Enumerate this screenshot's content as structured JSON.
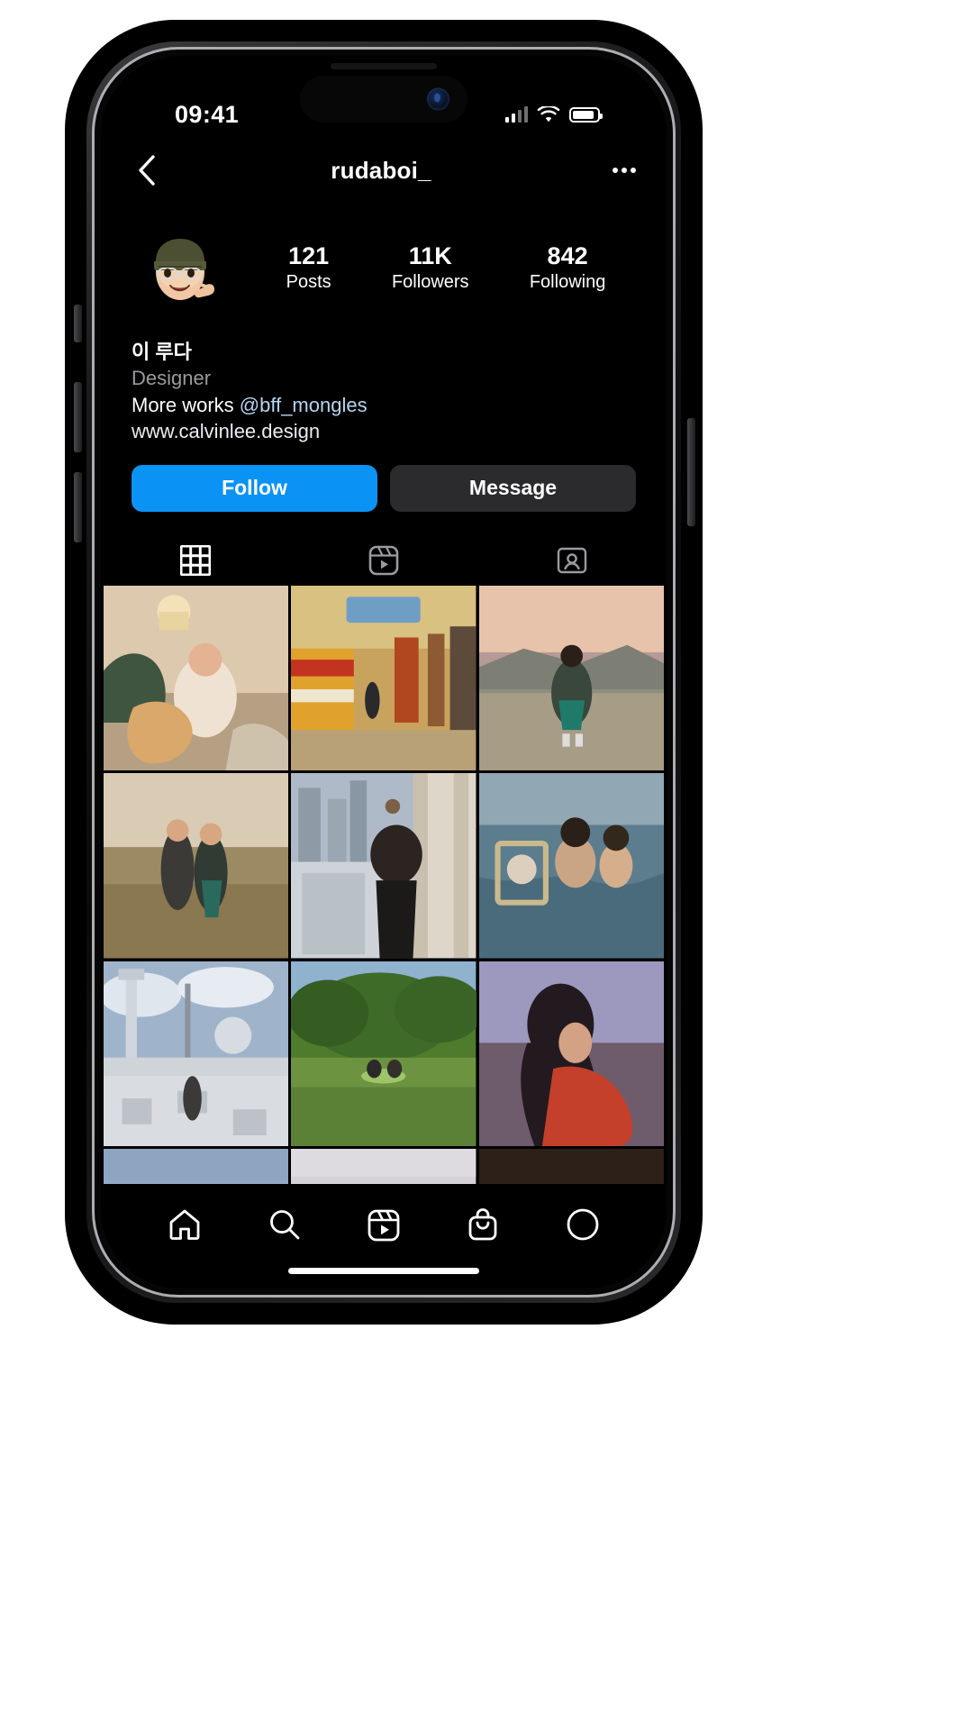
{
  "status_bar": {
    "time": "09:41",
    "signal_icon": "cellular-signal-icon",
    "wifi_icon": "wifi-icon",
    "battery_icon": "battery-icon"
  },
  "nav": {
    "back_icon": "chevron-left-icon",
    "title": "rudaboi_",
    "more_icon": "more-options-icon"
  },
  "profile": {
    "avatar_name": "memoji-avatar",
    "stats": [
      {
        "value": "121",
        "label": "Posts"
      },
      {
        "value": "11K",
        "label": "Followers"
      },
      {
        "value": "842",
        "label": "Following"
      }
    ],
    "bio": {
      "name": "이 루다",
      "category": "Designer",
      "description_prefix": "More works ",
      "mention": "@bff_mongles",
      "link": "www.calvinlee.design"
    },
    "buttons": {
      "follow": "Follow",
      "message": "Message"
    },
    "tabs": [
      {
        "name": "grid",
        "icon": "grid-icon",
        "active": true
      },
      {
        "name": "reels",
        "icon": "reels-icon",
        "active": false
      },
      {
        "name": "tagged",
        "icon": "tagged-icon",
        "active": false
      }
    ]
  },
  "bottom_nav": [
    {
      "name": "home",
      "icon": "home-icon"
    },
    {
      "name": "search",
      "icon": "search-icon"
    },
    {
      "name": "reels",
      "icon": "reels-icon"
    },
    {
      "name": "shop",
      "icon": "shop-bag-icon"
    },
    {
      "name": "profile",
      "icon": "profile-circle-icon"
    }
  ],
  "colors": {
    "accent_blue": "#0a93f5",
    "secondary_button": "#2b2b2d",
    "background": "#000000",
    "muted_text": "#9a9a9f",
    "mention_text": "#b7d4f0"
  },
  "grid_posts": [
    {
      "alt": "woman-on-sofa-indoor",
      "c1": "#e8d9c4",
      "c2": "#b08f6a",
      "c3": "#6b4f35"
    },
    {
      "alt": "subway-platform-yellow-train",
      "c1": "#d8c48a",
      "c2": "#c0732a",
      "c3": "#2a3540"
    },
    {
      "alt": "woman-walking-at-dusk",
      "c1": "#e7c7b2",
      "c2": "#8d8f7e",
      "c3": "#4b4f44"
    },
    {
      "alt": "couple-in-dry-field",
      "c1": "#d9cdb6",
      "c2": "#9a8a6d",
      "c3": "#5a5240"
    },
    {
      "alt": "woman-city-skyline-backview",
      "c1": "#c6cdd4",
      "c2": "#8f969d",
      "c3": "#2e3338"
    },
    {
      "alt": "couple-in-water-with-mirror",
      "c1": "#8fa7b4",
      "c2": "#55707f",
      "c3": "#2c3c47"
    },
    {
      "alt": "plaza-with-monument",
      "c1": "#cfd8e0",
      "c2": "#9aa6b2",
      "c3": "#6d7680"
    },
    {
      "alt": "picnic-on-green-lawn",
      "c1": "#9fc06a",
      "c2": "#4d7a2e",
      "c3": "#2a4a1c"
    },
    {
      "alt": "woman-in-red-dress-motion",
      "c1": "#a09ab8",
      "c2": "#7a5a62",
      "c3": "#3a2630"
    },
    {
      "alt": "blue-sky-landscape",
      "c1": "#93a9c4",
      "c2": "#7d96b5",
      "c3": "#6c86a6"
    },
    {
      "alt": "pale-grey-scene",
      "c1": "#d8d6da",
      "c2": "#c9c6cc",
      "c3": "#bcb9c0"
    },
    {
      "alt": "dark-warm-scene",
      "c1": "#3a2a22",
      "c2": "#2a1d18",
      "c3": "#1a120e"
    }
  ]
}
